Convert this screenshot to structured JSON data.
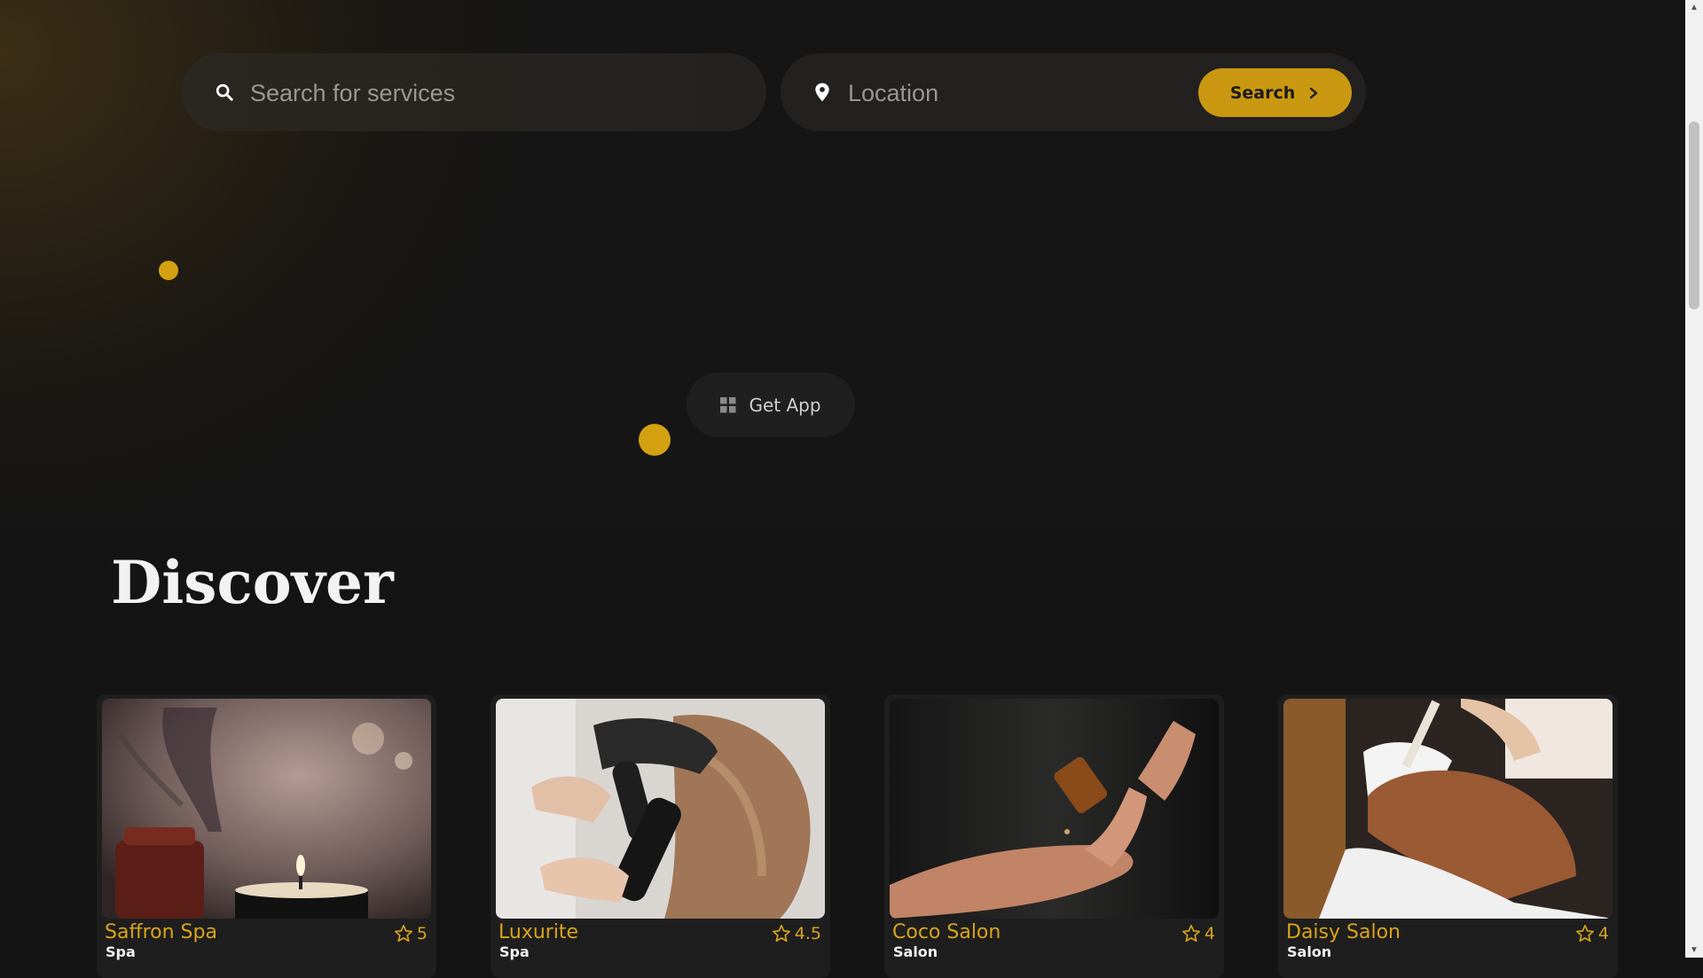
{
  "search": {
    "services_placeholder": "Search for services",
    "location_placeholder": "Location",
    "button_label": "Search"
  },
  "get_app": {
    "label": "Get App"
  },
  "discover": {
    "title": "Discover",
    "cards": [
      {
        "name": "Saffron Spa",
        "category": "Spa",
        "rating": "5",
        "photo": "candle-spa-photo"
      },
      {
        "name": "Luxurite",
        "category": "Spa",
        "rating": "4.5",
        "photo": "hair-blowdry-photo"
      },
      {
        "name": "Coco Salon",
        "category": "Salon",
        "rating": "4",
        "photo": "oil-dropper-photo"
      },
      {
        "name": "Daisy Salon",
        "category": "Salon",
        "rating": "4",
        "photo": "face-mask-photo"
      }
    ]
  },
  "icons": {
    "search": "search-icon",
    "location": "location-pin-icon",
    "chevron": "chevron-right-icon",
    "grid": "grid-icon",
    "star": "star-outline-icon"
  },
  "colors": {
    "accent": "#c99810",
    "background": "#141414",
    "card": "#1e1e1e",
    "card_name": "#d9a41b"
  }
}
